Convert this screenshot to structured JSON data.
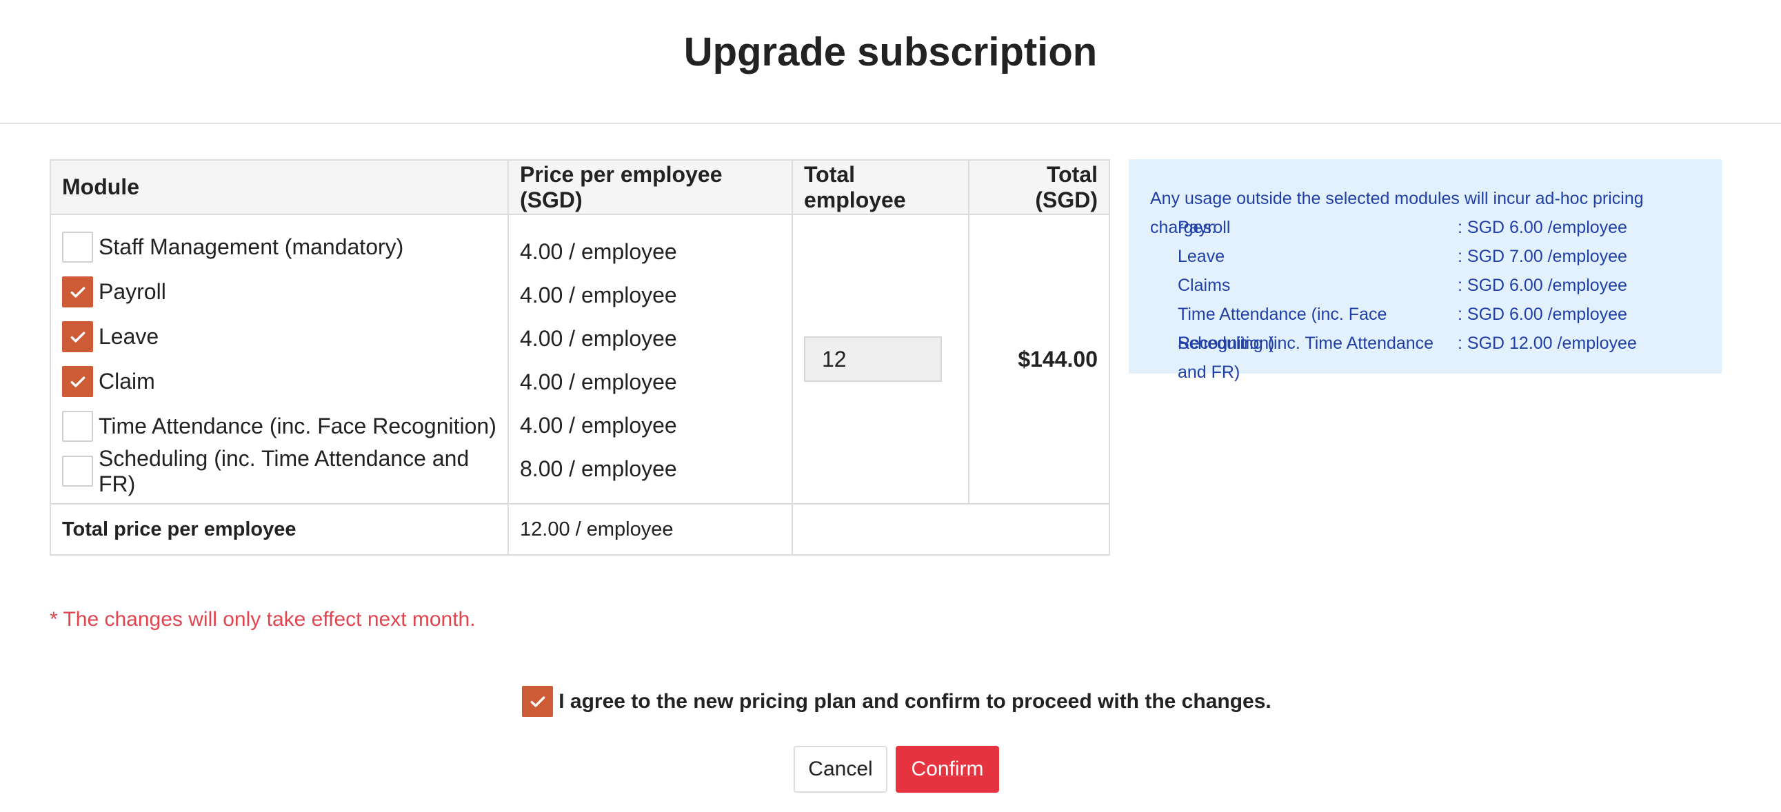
{
  "page": {
    "title": "Upgrade subscription"
  },
  "table": {
    "headers": {
      "module": "Module",
      "price": "Price per employee (SGD)",
      "employees": "Total employee",
      "total": "Total (SGD)"
    },
    "modules": [
      {
        "label": "Staff Management (mandatory)",
        "checked": false,
        "price": "4.00 / employee"
      },
      {
        "label": "Payroll",
        "checked": true,
        "price": "4.00 / employee"
      },
      {
        "label": "Leave",
        "checked": true,
        "price": "4.00 / employee"
      },
      {
        "label": "Claim",
        "checked": true,
        "price": "4.00 / employee"
      },
      {
        "label": "Time Attendance (inc. Face Recognition)",
        "checked": false,
        "price": "4.00 / employee"
      },
      {
        "label": "Scheduling (inc. Time Attendance and FR)",
        "checked": false,
        "price": "8.00 / employee"
      }
    ],
    "employee_count": "12",
    "total_amount": "$144.00",
    "footer": {
      "label": "Total price per employee",
      "value": "12.00 / employee"
    }
  },
  "info": {
    "heading": "Any usage outside the selected modules will incur ad-hoc pricing charges:",
    "rates": [
      {
        "name": "Payroll",
        "value": ": SGD 6.00 /employee"
      },
      {
        "name": "Leave",
        "value": ": SGD 7.00 /employee"
      },
      {
        "name": "Claims",
        "value": ": SGD 6.00 /employee"
      },
      {
        "name": "Time Attendance (inc. Face Recognition)",
        "value": ": SGD 6.00 /employee"
      },
      {
        "name": "Scheduling (inc. Time Attendance and FR)",
        "value": ": SGD 12.00 /employee"
      }
    ]
  },
  "note": "* The changes will only take effect next month.",
  "agreement": {
    "checked": true,
    "text": "I agree to the new pricing plan and confirm to proceed with the changes."
  },
  "buttons": {
    "cancel": "Cancel",
    "confirm": "Confirm"
  },
  "colors": {
    "checkbox_accent": "#cd5c36",
    "confirm_button": "#e5343f",
    "note_text": "#e0454f",
    "info_bg": "#e3f1fd",
    "info_text": "#2040a8"
  }
}
